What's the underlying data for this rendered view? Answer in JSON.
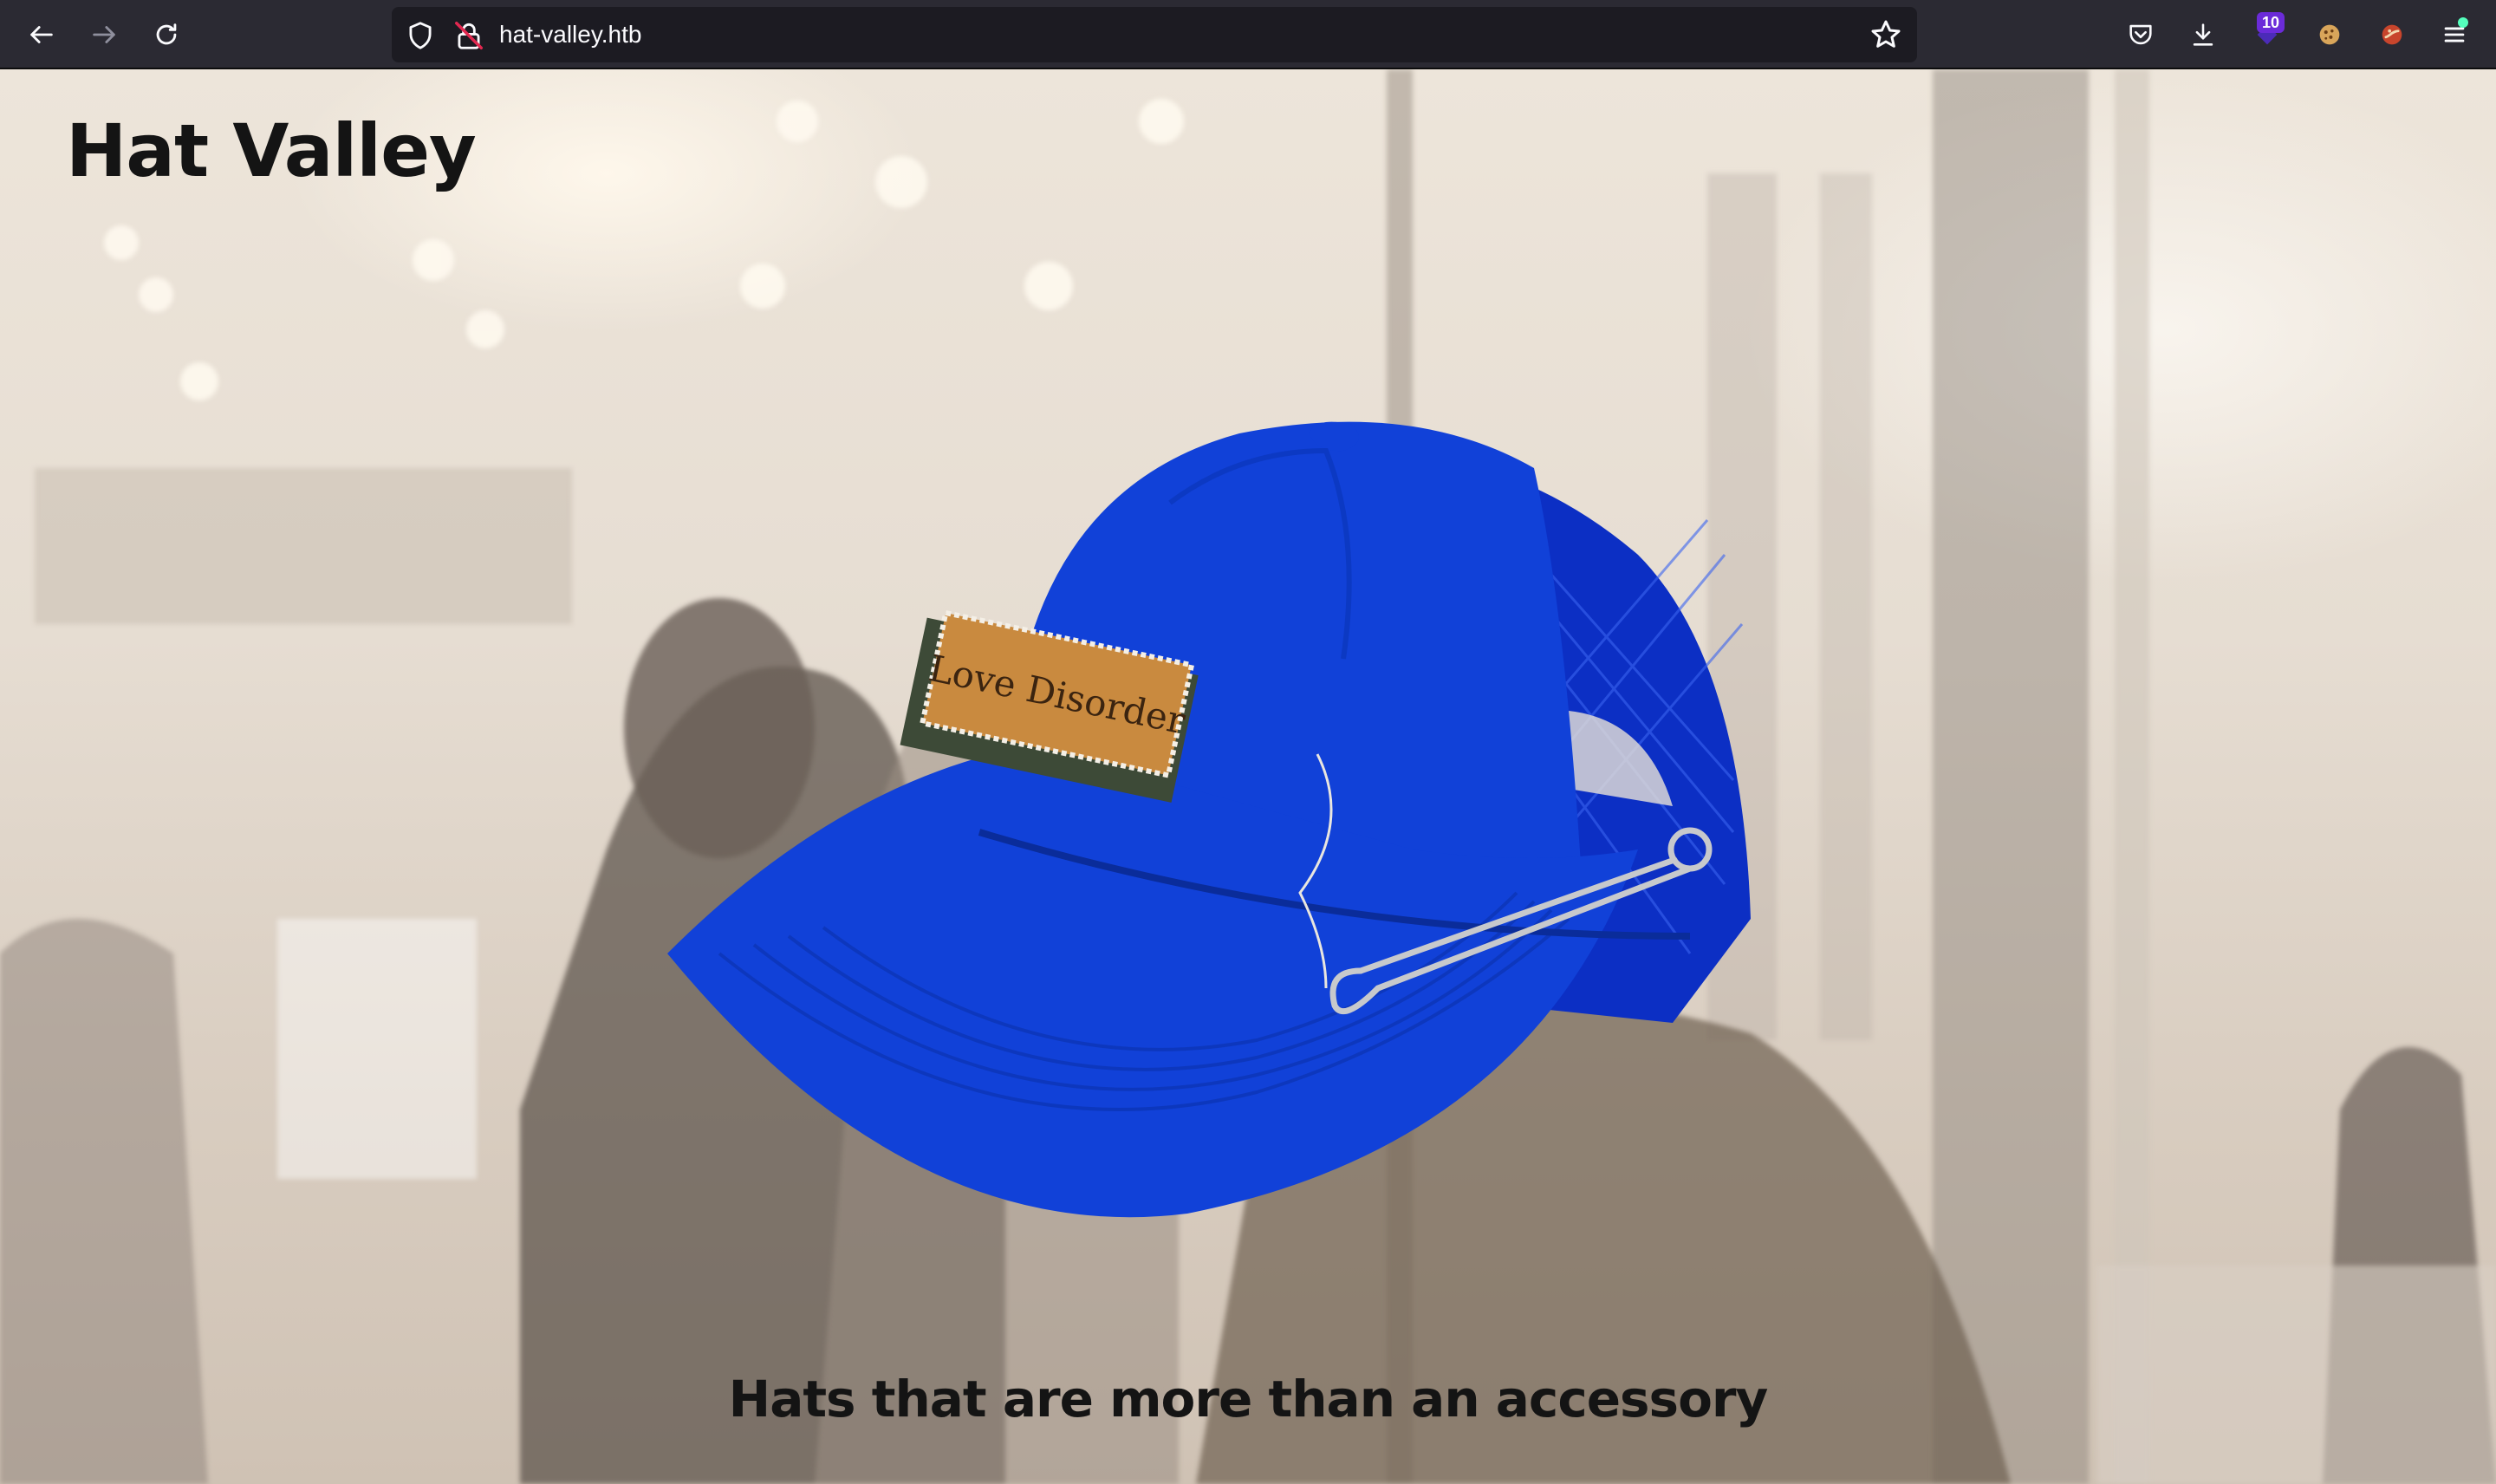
{
  "browser": {
    "url": "hat-valley.htb",
    "extension_badge_count": "10",
    "icons": {
      "back": "back-arrow-icon",
      "forward": "forward-arrow-icon",
      "reload": "reload-icon",
      "tracking_protection": "shield-icon",
      "security": "insecure-lock-icon",
      "bookmark": "star-icon",
      "pocket": "pocket-icon",
      "downloads": "download-icon",
      "extension_1": "extension-badge-icon",
      "extension_2": "cookie-icon",
      "extension_3": "extension-icon",
      "menu": "hamburger-menu-icon"
    },
    "colors": {
      "chrome": "#2b2a33",
      "urlbar": "#1c1b22",
      "badge": "#6b2bd9"
    }
  },
  "page": {
    "title": "Hat Valley",
    "tagline": "Hats that are more than an accessory",
    "hero_image": {
      "subject": "blue trucker hat",
      "patch_text": "Love Disorder"
    },
    "colors": {
      "hat_blue": "#1141d8",
      "patch_tan": "#c98a3f",
      "text": "#141414"
    }
  }
}
